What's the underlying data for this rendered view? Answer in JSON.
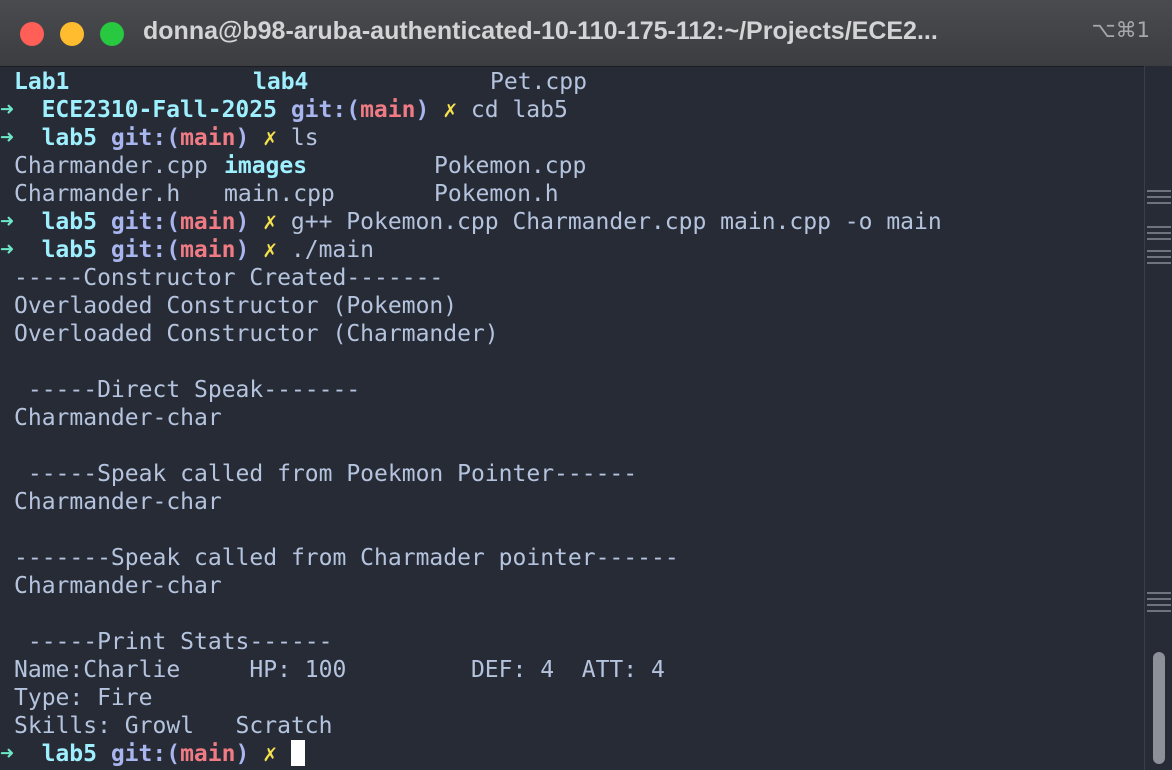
{
  "window": {
    "title": "donna@b98-aruba-authenticated-10-110-175-112:~/Projects/ECE2...",
    "shortcut": "⌥⌘1"
  },
  "prompt": {
    "arrow": "➜",
    "git_label": "git:",
    "open_paren": "(",
    "branch": "main",
    "close_paren": ")",
    "dirty_mark": "✗"
  },
  "terminal": {
    "ls1": {
      "col1": "Lab1",
      "col2": "lab4",
      "col3": "Pet.cpp"
    },
    "cmd1": {
      "dir": "ECE2310-Fall-2025",
      "command": "cd lab5"
    },
    "cmd2": {
      "dir": "lab5",
      "command": "ls"
    },
    "ls2_row1": {
      "col1": "Charmander.cpp",
      "col2": "images",
      "col3": "Pokemon.cpp"
    },
    "ls2_row2": {
      "col1": "Charmander.h",
      "col2": "main.cpp",
      "col3": "Pokemon.h"
    },
    "cmd3": {
      "dir": "lab5",
      "command": "g++ Pokemon.cpp Charmander.cpp main.cpp -o main"
    },
    "cmd4": {
      "dir": "lab5",
      "command": "./main"
    },
    "output": [
      "-----Constructor Created-------",
      "Overlaoded Constructor (Pokemon)",
      "Overloaded Constructor (Charmander)",
      "",
      " -----Direct Speak-------",
      "Charmander-char",
      "",
      " -----Speak called from Poekmon Pointer------",
      "Charmander-char",
      "",
      "-------Speak called from Charmader pointer------",
      "Charmander-char",
      "",
      " -----Print Stats------",
      "Name:Charlie     HP: 100         DEF: 4  ATT: 4",
      "Type: Fire",
      "Skills: Growl   Scratch"
    ],
    "cmd5": {
      "dir": "lab5",
      "command": ""
    }
  }
}
